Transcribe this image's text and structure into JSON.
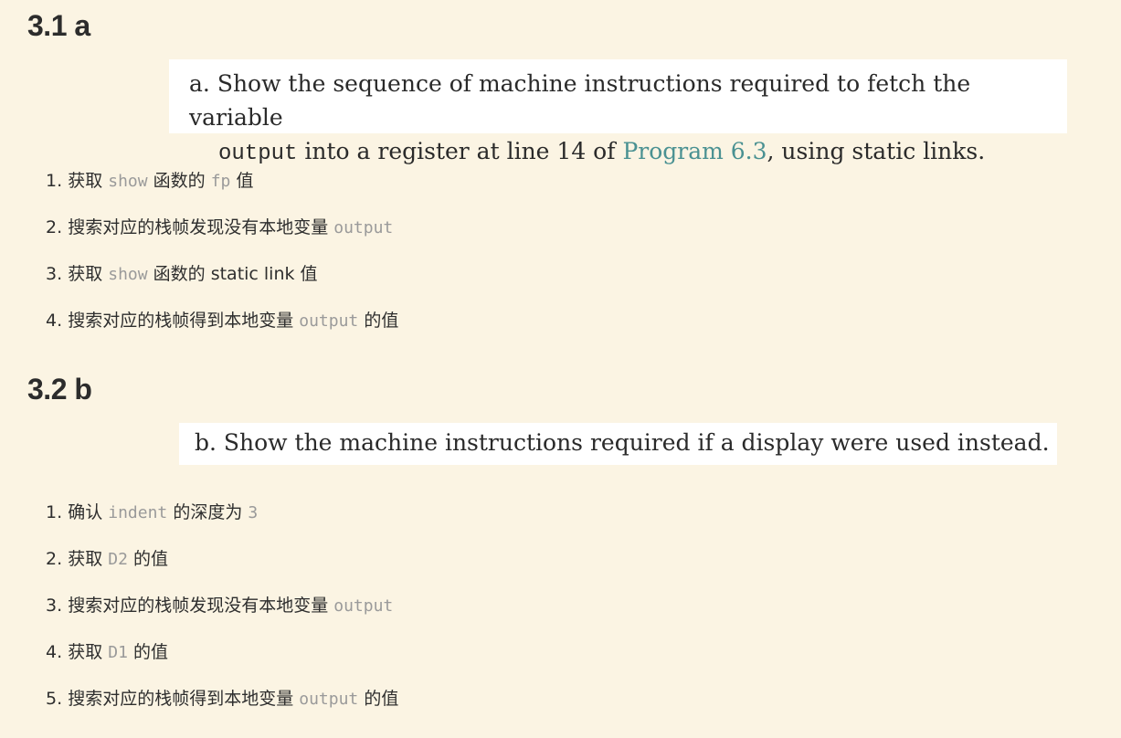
{
  "section_a": {
    "heading": "3.1 a",
    "question": {
      "label": "a.",
      "line1": "Show the sequence of machine instructions required to fetch the variable",
      "code": "output",
      "line2_mid": "into a register at line 14 of",
      "link": "Program 6.3",
      "line2_end": ", using static links."
    },
    "steps": [
      {
        "num": "1.",
        "t1": "获取",
        "c1": "show",
        "t2": "函数的",
        "c2": "fp",
        "t3": "值"
      },
      {
        "num": "2.",
        "t1": "搜索对应的栈帧发现没有本地变量",
        "c1": "output",
        "t2": "",
        "c2": "",
        "t3": ""
      },
      {
        "num": "3.",
        "t1": "获取",
        "c1": "show",
        "t2": "函数的 static link 值",
        "c2": "",
        "t3": ""
      },
      {
        "num": "4.",
        "t1": "搜索对应的栈帧得到本地变量",
        "c1": "output",
        "t2": "的值",
        "c2": "",
        "t3": ""
      }
    ]
  },
  "section_b": {
    "heading": "3.2 b",
    "question": {
      "text": "b. Show the machine instructions required if a display were used instead."
    },
    "steps": [
      {
        "num": "1.",
        "t1": "确认",
        "c1": "indent",
        "t2": "的深度为",
        "c2": "3",
        "t3": ""
      },
      {
        "num": "2.",
        "t1": "获取",
        "c1": "D2",
        "t2": "的值",
        "c2": "",
        "t3": ""
      },
      {
        "num": "3.",
        "t1": "搜索对应的栈帧发现没有本地变量",
        "c1": "output",
        "t2": "",
        "c2": "",
        "t3": ""
      },
      {
        "num": "4.",
        "t1": "获取",
        "c1": "D1",
        "t2": "的值",
        "c2": "",
        "t3": ""
      },
      {
        "num": "5.",
        "t1": "搜索对应的栈帧得到本地变量",
        "c1": "output",
        "t2": "的值",
        "c2": "",
        "t3": ""
      }
    ]
  }
}
